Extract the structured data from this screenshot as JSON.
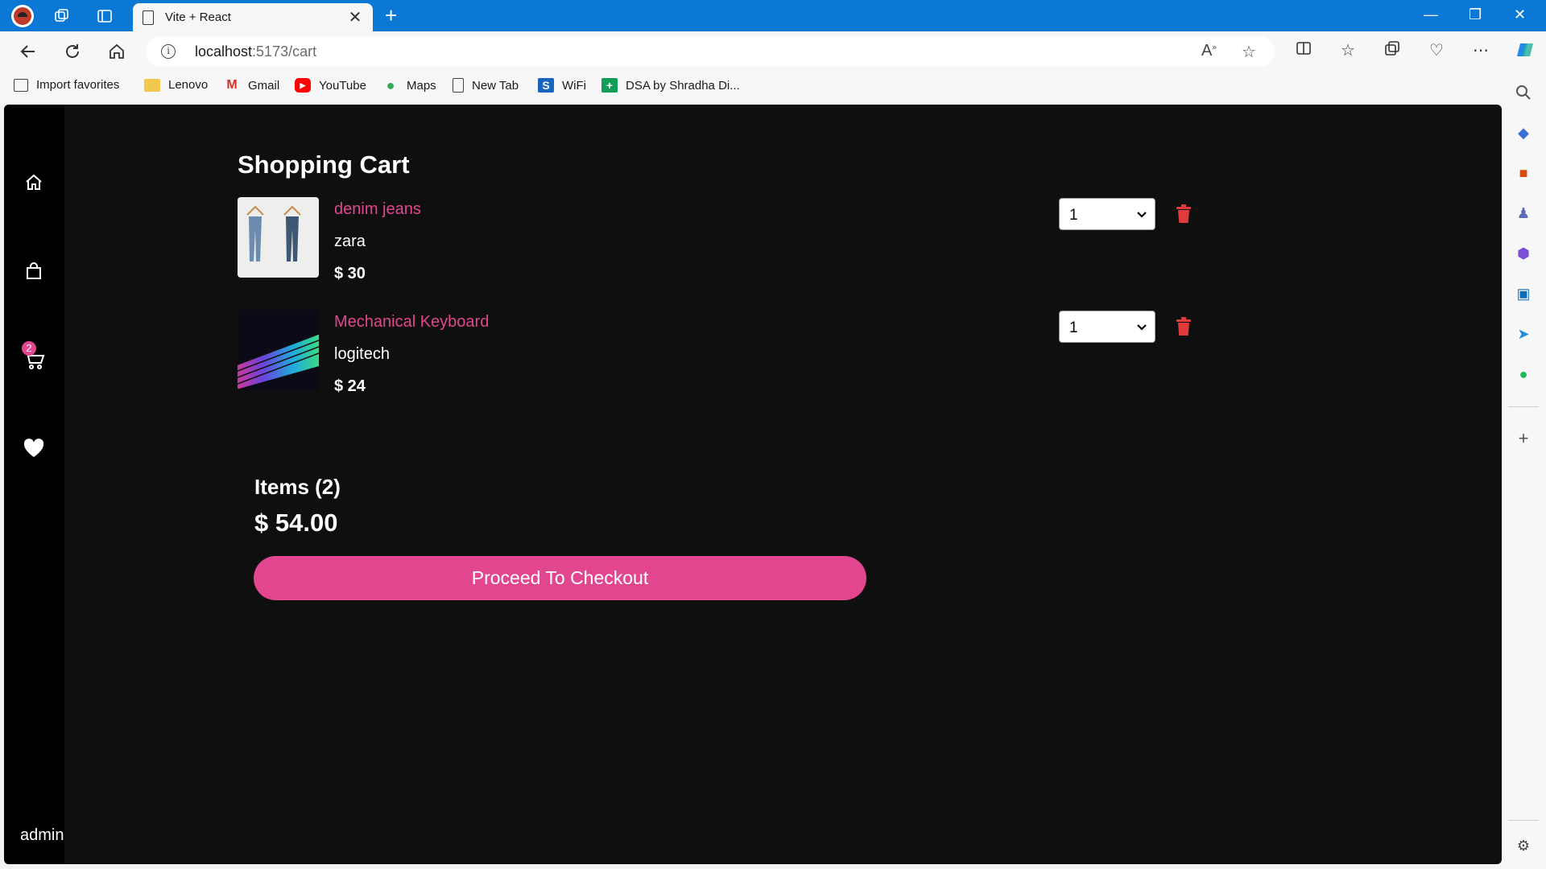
{
  "browser": {
    "tab_title": "Vite + React",
    "tab_close": "✕",
    "new_tab": "+",
    "url_host": "localhost",
    "url_path": ":5173/cart",
    "window_controls": {
      "minimize": "—",
      "restore": "❐",
      "close": "✕"
    }
  },
  "favorites": [
    {
      "label": "Import favorites",
      "icon": "import-icon"
    },
    {
      "label": "Lenovo",
      "icon": "folder-icon"
    },
    {
      "label": "Gmail",
      "icon": "gmail-icon"
    },
    {
      "label": "YouTube",
      "icon": "youtube-icon"
    },
    {
      "label": "Maps",
      "icon": "maps-icon"
    },
    {
      "label": "New Tab",
      "icon": "page-icon"
    },
    {
      "label": "WiFi",
      "icon": "wifi-s-icon"
    },
    {
      "label": "DSA by Shradha Di...",
      "icon": "sheets-icon"
    }
  ],
  "sidebar": {
    "cart_count": "2",
    "user": "admin"
  },
  "cart": {
    "title": "Shopping Cart",
    "items": [
      {
        "name": "denim jeans",
        "brand": "zara",
        "price": "$ 30",
        "qty": "1"
      },
      {
        "name": "Mechanical Keyboard",
        "brand": "logitech",
        "price": "$ 24",
        "qty": "1"
      }
    ],
    "summary_items": "Items (2)",
    "summary_total": "$ 54.00",
    "checkout_label": "Proceed To Checkout"
  },
  "colors": {
    "accent": "#e2468f",
    "page_bg": "#0f0f0f",
    "sidebar_bg": "#000000",
    "browser_chrome": "#0a78d4",
    "delete": "#e03a3a"
  }
}
